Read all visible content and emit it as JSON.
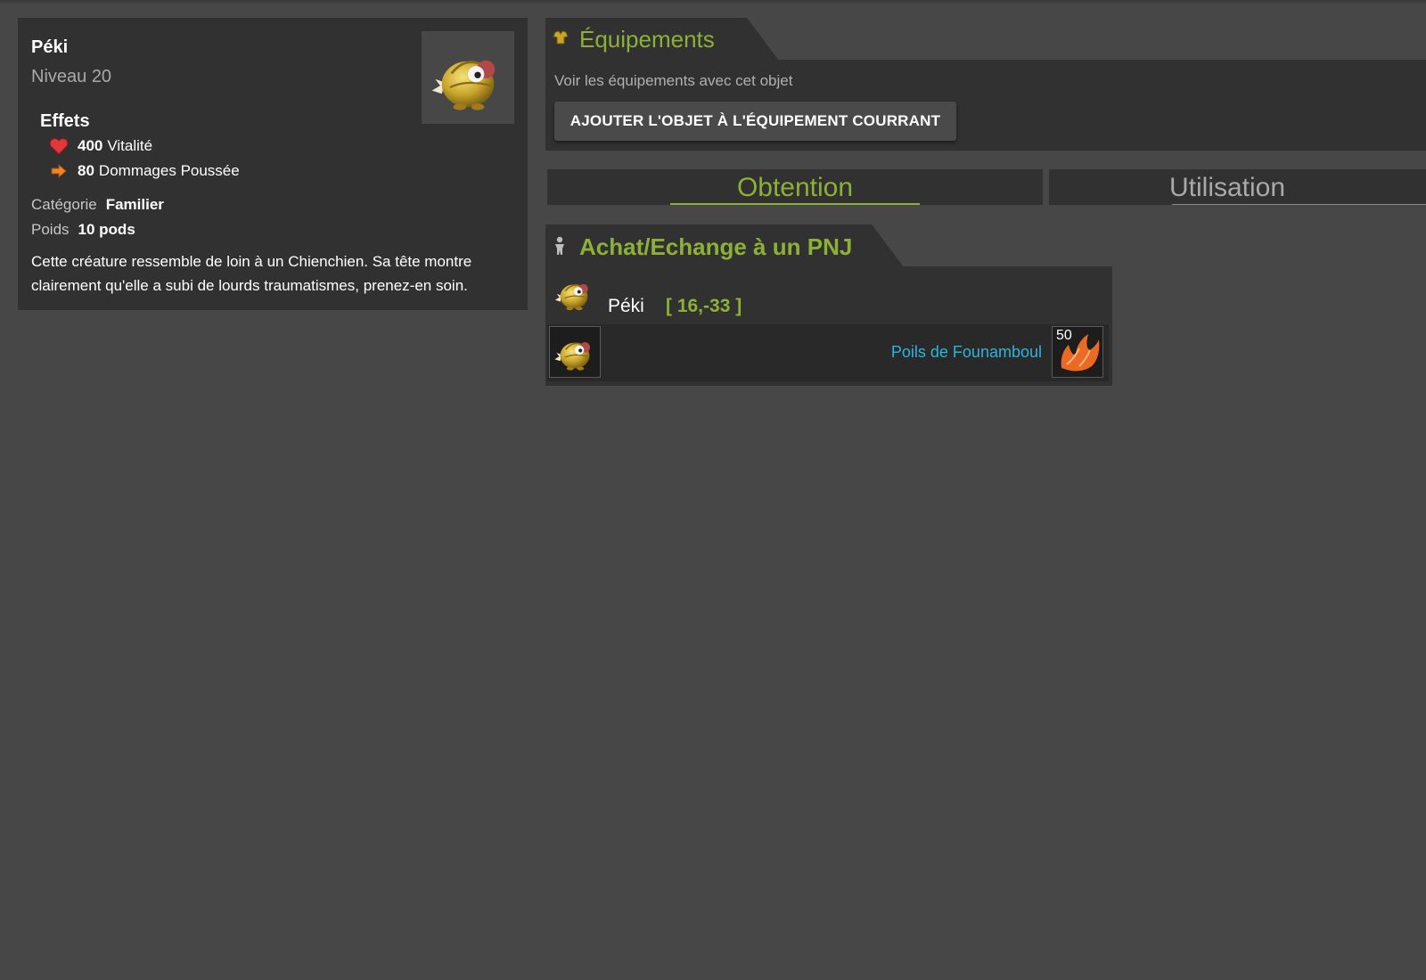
{
  "item": {
    "name": "Péki",
    "level": "Niveau 20",
    "effects_title": "Effets",
    "effects": [
      {
        "value": "400",
        "label": "Vitalité",
        "icon": "heart-icon"
      },
      {
        "value": "80",
        "label": "Dommages Poussée",
        "icon": "arrow-right-icon"
      }
    ],
    "category_label": "Catégorie",
    "category_value": "Familier",
    "weight_label": "Poids",
    "weight_value": "10 pods",
    "description": "Cette créature ressemble de loin à un Chienchien. Sa tête montre clairement qu'elle a subi de lourds traumatismes, prenez-en soin."
  },
  "equipements": {
    "title": "Équipements",
    "icon": "equipment-icon",
    "subtitle": "Voir les équipements avec cet objet",
    "add_button": "AJOUTER L'OBJET À L'ÉQUIPEMENT COURRANT"
  },
  "tabs": [
    {
      "label": "Obtention",
      "active": true
    },
    {
      "label": "Utilisation",
      "active": false
    }
  ],
  "pnj": {
    "title": "Achat/Echange à un PNJ",
    "icon": "person-icon",
    "npc_name": "Péki",
    "npc_coords": "[ 16,-33 ]",
    "trade_item_name": "Poils de Founamboul",
    "trade_quantity": "50"
  },
  "colors": {
    "accent_green": "#8db036",
    "link_blue": "#2bb5dd",
    "panel_bg": "#313131",
    "page_bg": "#474747"
  }
}
